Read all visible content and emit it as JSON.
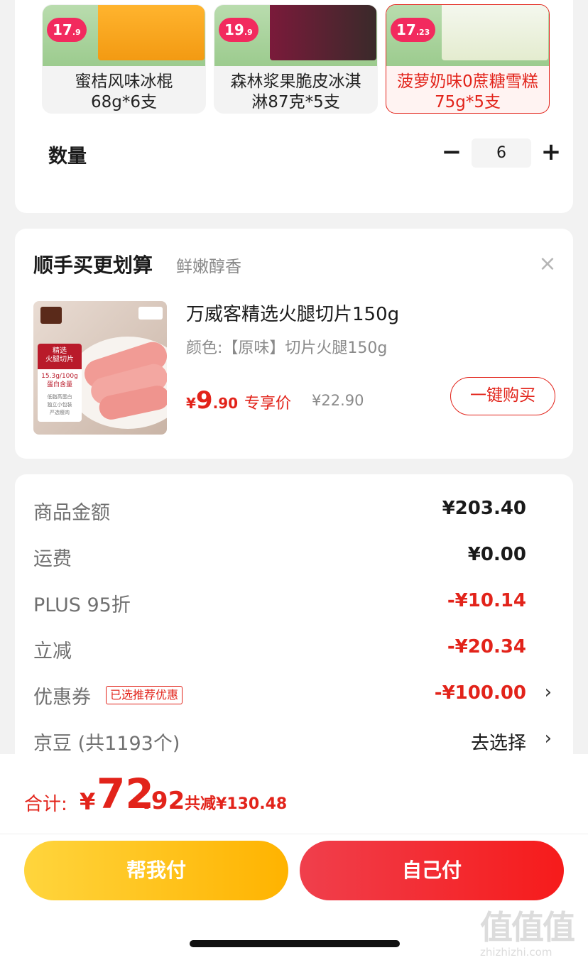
{
  "variants": [
    {
      "price_int": "17",
      "price_dec": ".9",
      "name_line1": "蜜桔风味冰棍",
      "name_line2": "68g*6支",
      "selected": false
    },
    {
      "price_int": "19",
      "price_dec": ".9",
      "name_line1": "森林浆果脆皮冰淇",
      "name_line2": "淋87克*5支",
      "selected": false
    },
    {
      "price_int": "17",
      "price_dec": ".23",
      "name_line1": "菠萝奶味0蔗糖雪糕",
      "name_line2": "75g*5支",
      "selected": true
    }
  ],
  "quantity": {
    "label": "数量",
    "minus": "−",
    "value": "6",
    "plus": "+"
  },
  "addon": {
    "title": "顺手买更划算",
    "subtitle": "鲜嫩醇香",
    "close": "×",
    "product_name": "万威客精选火腿切片150g",
    "spec": "颜色:【原味】切片火腿150g",
    "price_symbol": "¥",
    "price_int": "9",
    "price_dec": ".90",
    "price_label": "专享价",
    "original_price": "¥22.90",
    "buy_button": "一键购买",
    "image_tag_title": "精选\n火腿切片",
    "image_tag_protein": "15.3g/100g\n蛋白含量",
    "image_tag_features": "低脂高蛋白\n独立小包装\n严选瘦肉"
  },
  "summary": [
    {
      "label": "商品金额",
      "value": "¥203.40",
      "style": "bold"
    },
    {
      "label": "运费",
      "value": "¥0.00",
      "style": "bold"
    },
    {
      "label": "PLUS 95折",
      "value": "-¥10.14",
      "style": "red"
    },
    {
      "label": "立减",
      "value": "-¥20.34",
      "style": "red"
    },
    {
      "label": "优惠券",
      "tag": "已选推荐优惠",
      "value": "-¥100.00",
      "style": "red",
      "chevron": "›"
    },
    {
      "label": "京豆 (共1193个)",
      "value": "去选择",
      "style": "plain",
      "chevron": "›"
    }
  ],
  "bottom": {
    "total_label": "合计:",
    "total_symbol": "¥",
    "total_int": "72",
    "total_dec": ".92",
    "saved": "共减¥130.48",
    "help_pay": "帮我付",
    "self_pay": "自己付"
  },
  "watermark": {
    "big": "值值值",
    "small": "zhizhizhi.com"
  },
  "colors": {
    "accent": "#e2231a",
    "help_button": "#ffc21a",
    "self_button": "#f2292f"
  }
}
